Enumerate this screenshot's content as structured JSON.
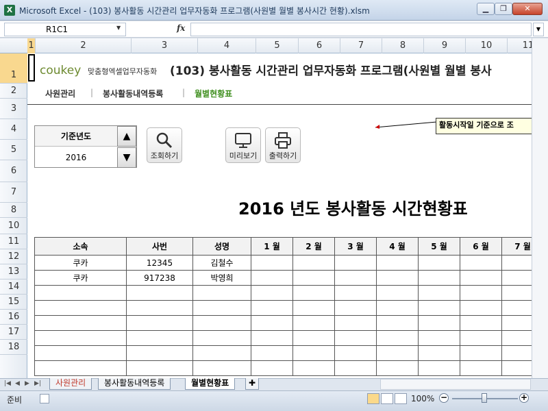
{
  "window": {
    "title": "Microsoft Excel - (103) 봉사활동 시간관리 업무자동화 프로그램(사원별 월별 봉사시간 현황).xlsm",
    "app_icon": "X"
  },
  "formula_bar": {
    "name_box": "R1C1",
    "fx": "fx",
    "value": ""
  },
  "columns": [
    "1",
    "2",
    "3",
    "4",
    "5",
    "6",
    "7",
    "8",
    "9",
    "10",
    "11"
  ],
  "rows": [
    "1",
    "2",
    "3",
    "4",
    "5",
    "6",
    "7",
    "8",
    "10",
    "11",
    "12",
    "13",
    "14",
    "15",
    "16",
    "17",
    "18"
  ],
  "sheet": {
    "logo_main": "coukey",
    "logo_sub": "맞춤형엑셀업무자동화",
    "title": "(103) 봉사활동 시간관리 업무자동화 프로그램(사원별 월별 봉사",
    "nav": [
      "사원관리",
      "봉사활동내역등록",
      "월별현황표"
    ],
    "nav_active_color": "#3f8f1f",
    "comment": "활동시작일 기준으로 조",
    "year_label": "기준년도",
    "year_value": "2016",
    "btn_search": "조회하기",
    "btn_preview": "미리보기",
    "btn_print": "출력하기",
    "report_title": "2016 년도 봉사활동 시간현황표"
  },
  "table": {
    "headers": [
      "소속",
      "사번",
      "성명",
      "1 월",
      "2 월",
      "3 월",
      "4 월",
      "5 월",
      "6 월",
      "7 월"
    ],
    "rows": [
      [
        "쿠카",
        "12345",
        "김철수"
      ],
      [
        "쿠카",
        "917238",
        "박영희"
      ]
    ],
    "empty_rows": 6
  },
  "tabs": [
    "사원관리",
    "봉사활동내역등록",
    "월별현황표"
  ],
  "active_tab": "월별현황표",
  "status": {
    "text": "준비",
    "zoom": "100%"
  }
}
